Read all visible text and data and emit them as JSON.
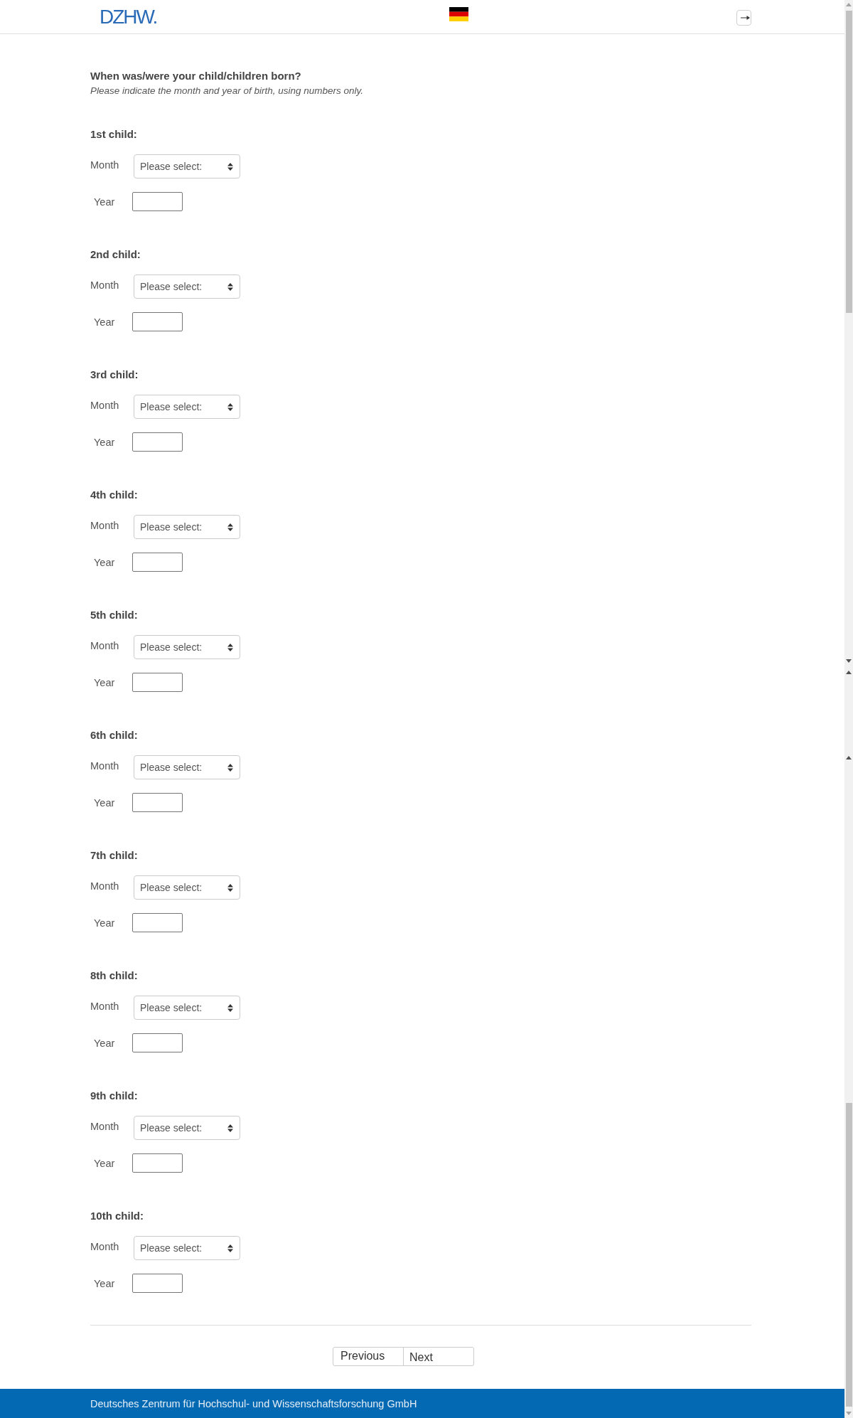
{
  "header": {
    "logo": "DZHW."
  },
  "question": {
    "title": "When was/were your child/children born?",
    "hint": "Please indicate the month and year of birth, using numbers only."
  },
  "children": [
    {
      "heading": "1st child:",
      "month": {
        "label": "Month",
        "placeholder": "Please select:"
      },
      "year": {
        "label": "Year"
      }
    },
    {
      "heading": "2nd child:",
      "month": {
        "label": "Month",
        "placeholder": "Please select:"
      },
      "year": {
        "label": "Year"
      }
    },
    {
      "heading": "3rd child:",
      "month": {
        "label": "Month",
        "placeholder": "Please select:"
      },
      "year": {
        "label": "Year"
      }
    },
    {
      "heading": "4th child:",
      "month": {
        "label": "Month",
        "placeholder": "Please select:"
      },
      "year": {
        "label": "Year"
      }
    },
    {
      "heading": "5th child:",
      "month": {
        "label": "Month",
        "placeholder": "Please select:"
      },
      "year": {
        "label": "Year"
      }
    },
    {
      "heading": "6th child:",
      "month": {
        "label": "Month",
        "placeholder": "Please select:"
      },
      "year": {
        "label": "Year"
      }
    },
    {
      "heading": "7th child:",
      "month": {
        "label": "Month",
        "placeholder": "Please select:"
      },
      "year": {
        "label": "Year"
      }
    },
    {
      "heading": "8th child:",
      "month": {
        "label": "Month",
        "placeholder": "Please select:"
      },
      "year": {
        "label": "Year"
      }
    },
    {
      "heading": "9th child:",
      "month": {
        "label": "Month",
        "placeholder": "Please select:"
      },
      "year": {
        "label": "Year"
      }
    },
    {
      "heading": "10th child:",
      "month": {
        "label": "Month",
        "placeholder": "Please select:"
      },
      "year": {
        "label": "Year"
      }
    }
  ],
  "navigation": {
    "buttons": [
      {
        "label": "Previous"
      },
      {
        "label": "Next"
      }
    ]
  },
  "footer": {
    "text": "Deutsches Zentrum für Hochschul- und Wissenschaftsforschung GmbH"
  }
}
